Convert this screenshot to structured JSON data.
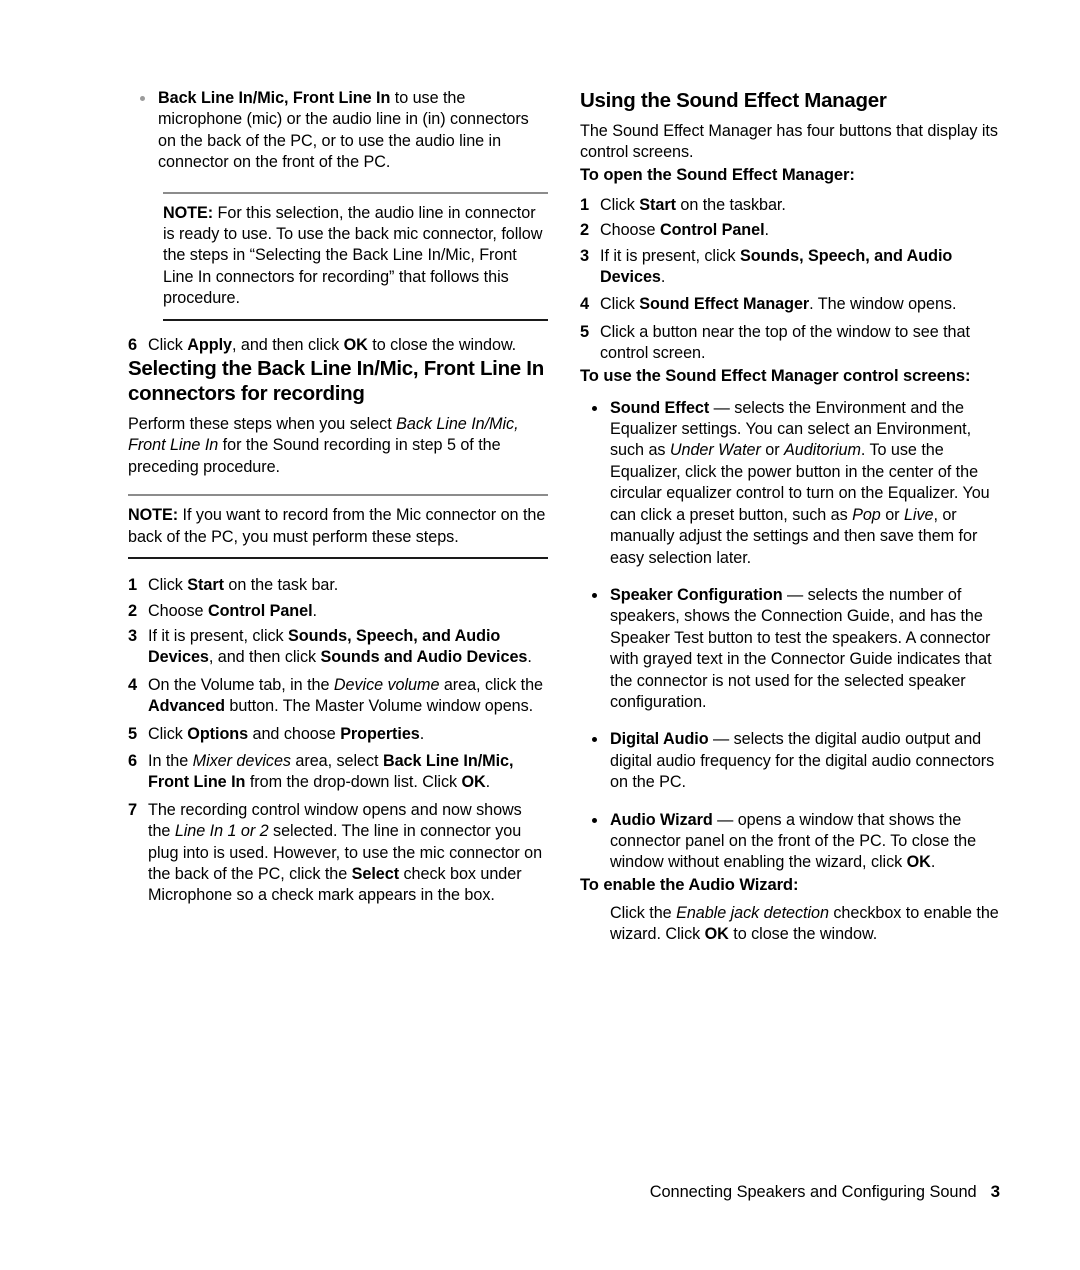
{
  "document": {
    "footer_text": "Connecting Speakers and Configuring Sound",
    "page_number": "3"
  },
  "left_column": {
    "bullet_back_line_in": {
      "bold_lead": "Back Line In/Mic, Front Line In",
      "rest": " to use the microphone (mic) or the audio line in (in) connectors on the back of the PC, or to use the audio line in connector on the front of the PC."
    },
    "note_1": {
      "label": "NOTE:",
      "text": " For this selection, the audio line in connector is ready to use. To use the back mic connector, follow the steps in “Selecting the Back Line In/Mic, Front Line In connectors for recording” that follows this procedure."
    },
    "step_6_apply": {
      "num": "6",
      "part1": "Click ",
      "bold1": "Apply",
      "part2": ", and then click ",
      "bold2": "OK",
      "part3": " to close the window."
    },
    "heading": "Selecting the Back Line In/Mic, Front Line In connectors for recording",
    "intro": {
      "part1": "Perform these steps when you select ",
      "italic1": "Back Line In/Mic, Front Line In",
      "part2": " for the Sound recording in step 5 of the preceding procedure."
    },
    "note_2": {
      "label": "NOTE:",
      "text": " If you want to record from the Mic connector on the back of the PC, you must perform these steps."
    },
    "steps": [
      {
        "num": "1",
        "html_key": "s1",
        "part1": "Click ",
        "bold1": "Start",
        "part2": " on the task bar."
      },
      {
        "num": "2",
        "html_key": "s2",
        "part1": "Choose ",
        "bold1": "Control Panel",
        "part2": "."
      },
      {
        "num": "3",
        "html_key": "s3",
        "part1": "If it is present, click ",
        "bold1": "Sounds, Speech, and Audio Devices",
        "part2": ", and then click ",
        "bold2": "Sounds and Audio Devices",
        "part3": "."
      },
      {
        "num": "4",
        "html_key": "s4",
        "part1": "On the Volume tab, in the ",
        "italic1": "Device volume",
        "part2": " area, click the ",
        "bold1": "Advanced",
        "part3": " button. The Master Volume window opens."
      },
      {
        "num": "5",
        "html_key": "s5",
        "part1": "Click ",
        "bold1": "Options",
        "part2": " and choose ",
        "bold2": "Properties",
        "part3": "."
      },
      {
        "num": "6",
        "html_key": "s6",
        "part1": "In the ",
        "italic1": "Mixer devices",
        "part2": " area, select ",
        "bold1": "Back Line In/Mic, Front Line In",
        "part3": " from the drop-down list. Click ",
        "bold2": "OK",
        "part4": "."
      },
      {
        "num": "7",
        "html_key": "s7",
        "part1": "The recording control window opens and now shows the ",
        "italic1": "Line In 1 or 2",
        "part2": " selected. The line in connector you plug into is used. However, to use the mic connector on the back of the PC, click the ",
        "bold1": "Select",
        "part3": " check box under Microphone so a check mark appears in the box."
      }
    ]
  },
  "right_column": {
    "heading": "Using the Sound Effect Manager",
    "intro": "The Sound Effect Manager has four buttons that display its control screens.",
    "subheading_open": "To open the Sound Effect Manager:",
    "open_steps": [
      {
        "num": "1",
        "part1": "Click ",
        "bold1": "Start",
        "part2": " on the taskbar."
      },
      {
        "num": "2",
        "part1": "Choose ",
        "bold1": "Control Panel",
        "part2": "."
      },
      {
        "num": "3",
        "part1": "If it is present, click ",
        "bold1": "Sounds, Speech, and Audio Devices",
        "part2": "."
      },
      {
        "num": "4",
        "part1": "Click ",
        "bold1": "Sound Effect Manager",
        "part2": ". The window opens."
      },
      {
        "num": "5",
        "part1": "Click a button near the top of the window to see that control screen.",
        "bold1": "",
        "part2": ""
      }
    ],
    "subheading_use": "To use the Sound Effect Manager control screens:",
    "bullets": [
      {
        "bold_lead": "Sound Effect",
        "dash": " — ",
        "p1": "selects the Environment and the Equalizer settings. You can select an Environment, such as ",
        "i1": "Under Water",
        "p2": " or ",
        "i2": "Auditorium",
        "p3": ". To use the Equalizer, click the power button in the center of the circular equalizer control to turn on the Equalizer. You can click a preset button, such as ",
        "i3": "Pop",
        "p4": " or ",
        "i4": "Live",
        "p5": ", or manually adjust the settings and then save them for easy selection later."
      },
      {
        "bold_lead": "Speaker Configuration",
        "dash": " — ",
        "p1": "selects the number of speakers, shows the Connection Guide, and has the Speaker Test button to test the speakers. A connector with grayed text in the Connector Guide indicates that the connector is not used for the selected speaker configuration."
      },
      {
        "bold_lead": "Digital Audio",
        "dash": " — ",
        "p1": "selects the digital audio output and digital audio frequency for the digital audio connectors on the PC."
      },
      {
        "bold_lead": "Audio Wizard",
        "dash": " — ",
        "p1": "opens a window that shows the connector panel on the front of the PC. To close the window without enabling the wizard, click ",
        "b1": "OK",
        "p2": "."
      }
    ],
    "subheading_wizard": "To enable the Audio Wizard:",
    "wizard_text": {
      "p1": "Click the ",
      "i1": "Enable jack detection",
      "p2": " checkbox to enable the wizard. Click ",
      "b1": "OK",
      "p3": " to close the window."
    }
  }
}
